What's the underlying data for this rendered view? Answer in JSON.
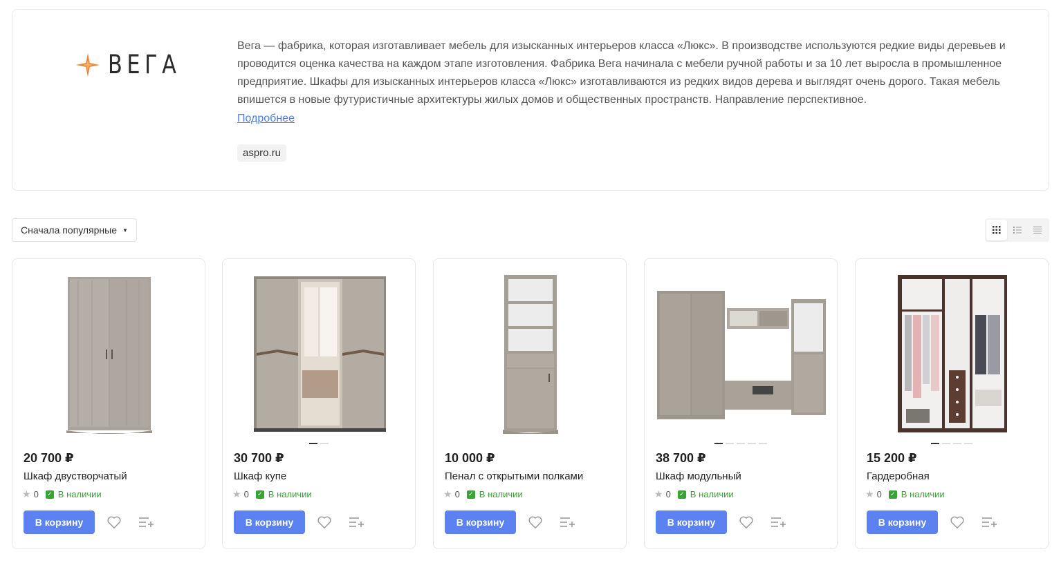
{
  "brand": {
    "logo_text": "ВЕГА",
    "description": "Вега — фабрика, которая изготавливает мебель для изысканных интерьеров класса «Люкс». В производстве используются редкие виды деревьев и проводится оценка качества на каждом этапе изготовления. Фабрика Вега начинала с мебели ручной работы и за 10 лет выросла в промышленное предприятие. Шкафы для изысканных интерьеров класса «Люкс» изготавливаются из редких видов дерева и выглядят очень дорого. Такая мебель впишется в новые футуристичные архитектуры жилых домов и общественных пространств. Направление перспективное.",
    "more_label": "Подробнее",
    "site": "aspro.ru",
    "accent_color": "#e8893a"
  },
  "toolbar": {
    "sort_label": "Сначала популярные",
    "views": [
      "grid-view-icon",
      "list-view-icon",
      "table-view-icon"
    ],
    "active_view": "grid-view-icon"
  },
  "products": [
    {
      "price": "20 700 ₽",
      "name": "Шкаф двустворчатый",
      "rating": "0",
      "stock": "В наличии",
      "buy_label": "В корзину",
      "slides": 1,
      "active_slide": 0
    },
    {
      "price": "30 700 ₽",
      "name": "Шкаф купе",
      "rating": "0",
      "stock": "В наличии",
      "buy_label": "В корзину",
      "slides": 2,
      "active_slide": 0
    },
    {
      "price": "10 000 ₽",
      "name": "Пенал с открытыми полками",
      "rating": "0",
      "stock": "В наличии",
      "buy_label": "В корзину",
      "slides": 1,
      "active_slide": 0
    },
    {
      "price": "38 700 ₽",
      "name": "Шкаф модульный",
      "rating": "0",
      "stock": "В наличии",
      "buy_label": "В корзину",
      "slides": 5,
      "active_slide": 0
    },
    {
      "price": "15 200 ₽",
      "name": "Гардеробная",
      "rating": "0",
      "stock": "В наличии",
      "buy_label": "В корзину",
      "slides": 4,
      "active_slide": 0
    }
  ],
  "colors": {
    "button": "#5b82f0",
    "in_stock": "#3aa335",
    "link": "#4a7ff0"
  }
}
